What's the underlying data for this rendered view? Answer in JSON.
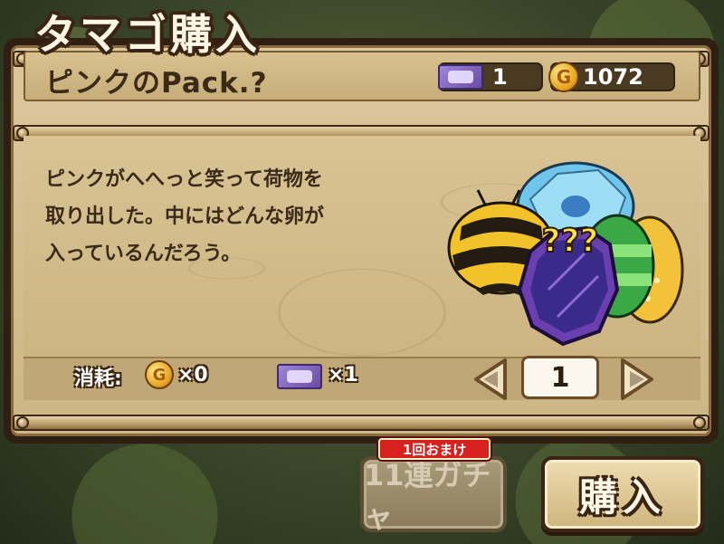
{
  "screen": {
    "title": "タマゴ購入"
  },
  "pack": {
    "name": "ピンクのPack.?",
    "description": "ピンクがへへっと笑って荷物を\n取り出した。中にはどんな卵が\n入っているんだろう。"
  },
  "currency": {
    "tickets": "1",
    "coins": "1072",
    "ticket_icon": "purple-ticket-icon",
    "coin_icon": "gold-coin-icon",
    "coin_glyph": "G"
  },
  "cost": {
    "label": "消耗:",
    "coin_value": "×0",
    "ticket_value": "×1"
  },
  "quantity": {
    "value": "1"
  },
  "buttons": {
    "bonus_tag": "1回おまけ",
    "gacha_label": "11連ガチャ",
    "buy_label": "購入"
  },
  "eggs": {
    "mystery_marks": "???"
  },
  "colors": {
    "panel_bg": "#dcc79d",
    "frame_dark": "#2e1f12",
    "bonus_red": "#d8201f",
    "egg_purple": "#6a3fb0"
  }
}
